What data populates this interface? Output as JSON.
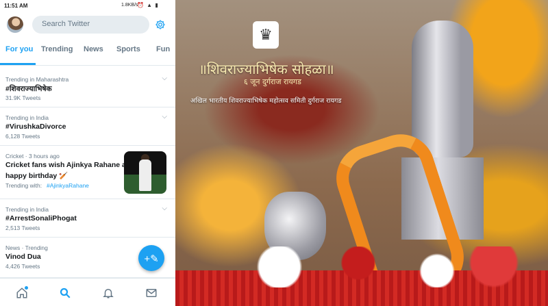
{
  "status_bar": {
    "time": "11:51 AM",
    "speed": "1.8KB/s",
    "icons": "⏰ ▲ ▮"
  },
  "header": {
    "search_placeholder": "Search Twitter"
  },
  "tabs": [
    {
      "label": "For you"
    },
    {
      "label": "Trending"
    },
    {
      "label": "News"
    },
    {
      "label": "Sports"
    },
    {
      "label": "Fun"
    }
  ],
  "trends": [
    {
      "meta": "Trending in Maharashtra",
      "name": "#शिवराज्याभिषेक",
      "count": "31.9K Tweets"
    },
    {
      "meta": "Trending in India",
      "name": "#VirushkaDivorce",
      "count": "6,128 Tweets"
    },
    {
      "meta": "Cricket · 3 hours ago",
      "name_line1": "Cricket fans wish Ajinkya Rahane a",
      "name_line2": "happy birthday 🏏",
      "trending_with_label": "Trending with:",
      "trending_with_tag": "#AjinkyaRahane"
    },
    {
      "meta": "Trending in India",
      "name": "#ArrestSonaliPhogat",
      "count": "2,513 Tweets"
    },
    {
      "meta": "News · Trending",
      "name": "Vinod Dua",
      "count": "4,426 Tweets"
    }
  ],
  "fab": {
    "icon": "+✎"
  },
  "hero": {
    "title": "॥शिवराज्याभिषेक सोहळा॥",
    "subtitle": "६ जून दुर्गराज रायगड",
    "org": "अखिल भारतीय शिवराज्याभिषेक महोत्सव समिती दुर्गराज रायगड",
    "emblem": "♛"
  },
  "colors": {
    "accent": "#1da1f2",
    "text": "#14171a",
    "muted": "#657786"
  }
}
